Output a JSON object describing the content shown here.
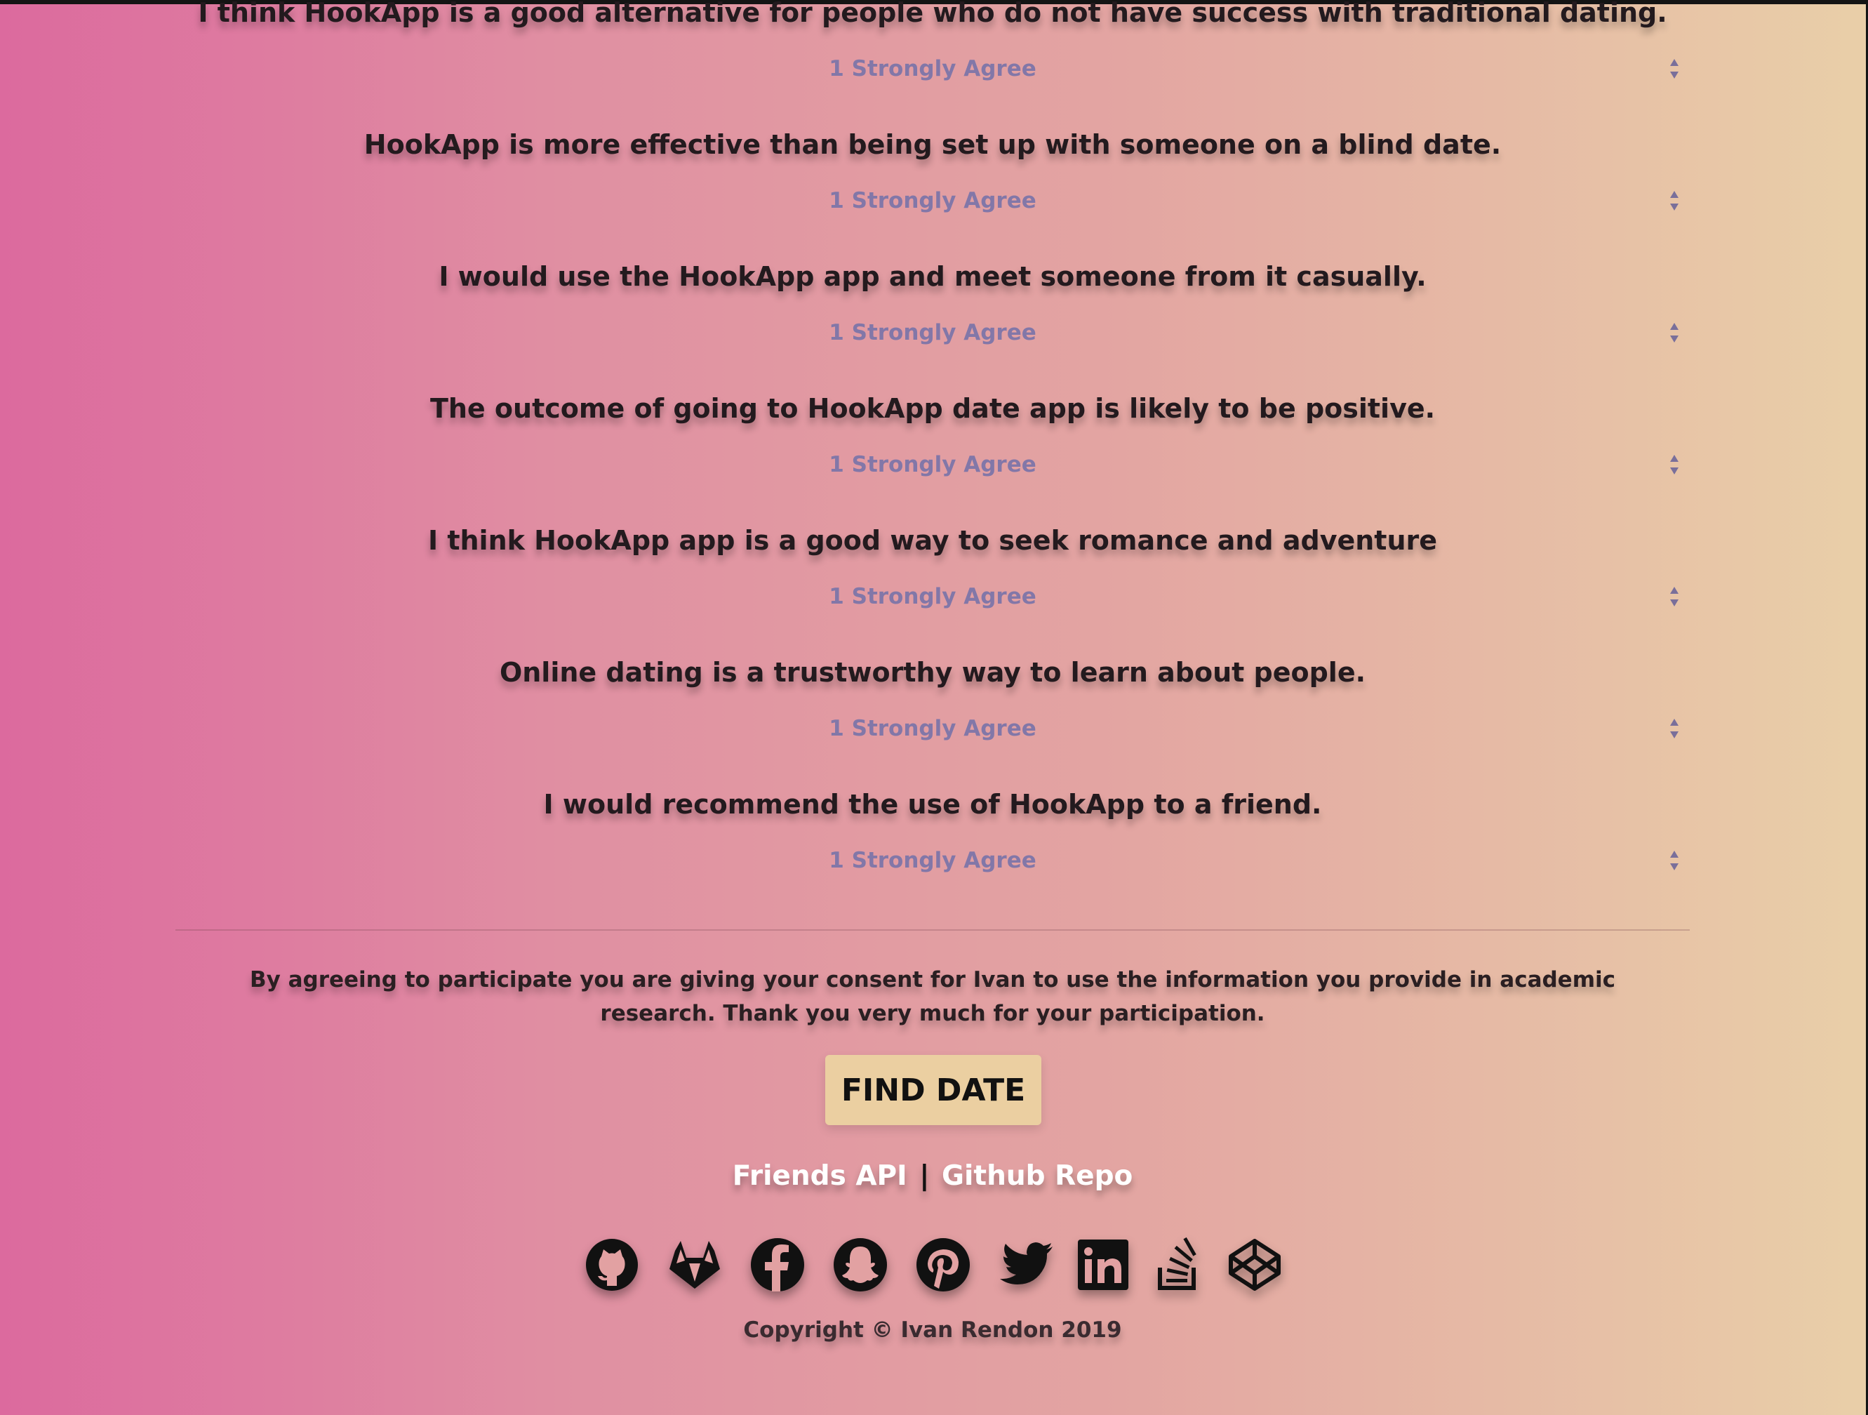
{
  "questions": [
    {
      "text": "I think HookApp is a good alternative for people who do not have success with traditional dating.",
      "selected": "1 Strongly Agree"
    },
    {
      "text": "HookApp is more effective than being set up with someone on a blind date.",
      "selected": "1 Strongly Agree"
    },
    {
      "text": "I would use the HookApp app and meet someone from it casually.",
      "selected": "1 Strongly Agree"
    },
    {
      "text": "The outcome of going to HookApp date app is likely to be positive.",
      "selected": "1 Strongly Agree"
    },
    {
      "text": "I think HookApp app is a good way to seek romance and adventure",
      "selected": "1 Strongly Agree"
    },
    {
      "text": "Online dating is a trustworthy way to learn about people.",
      "selected": "1 Strongly Agree"
    },
    {
      "text": "I would recommend the use of HookApp to a friend.",
      "selected": "1 Strongly Agree"
    }
  ],
  "consent": {
    "text": "By agreeing to participate you are giving your consent for Ivan to use the information you provide in academic research. Thank you very much for your participation."
  },
  "submit": {
    "label": "FIND DATE"
  },
  "footer": {
    "links": [
      {
        "label": "Friends API"
      },
      {
        "label": "Github Repo"
      }
    ],
    "separator": "|",
    "social_icons": [
      "github-icon",
      "gitlab-icon",
      "facebook-icon",
      "snapchat-icon",
      "pinterest-icon",
      "twitter-icon",
      "linkedin-icon",
      "stackoverflow-icon",
      "codepen-icon"
    ],
    "copyright": "Copyright © Ivan Rendon 2019"
  },
  "colors": {
    "gradient_left": "#dc6a9e",
    "gradient_right": "#e9cfa8",
    "button_bg": "#ebcfa1",
    "select_text": "#8277a8"
  }
}
